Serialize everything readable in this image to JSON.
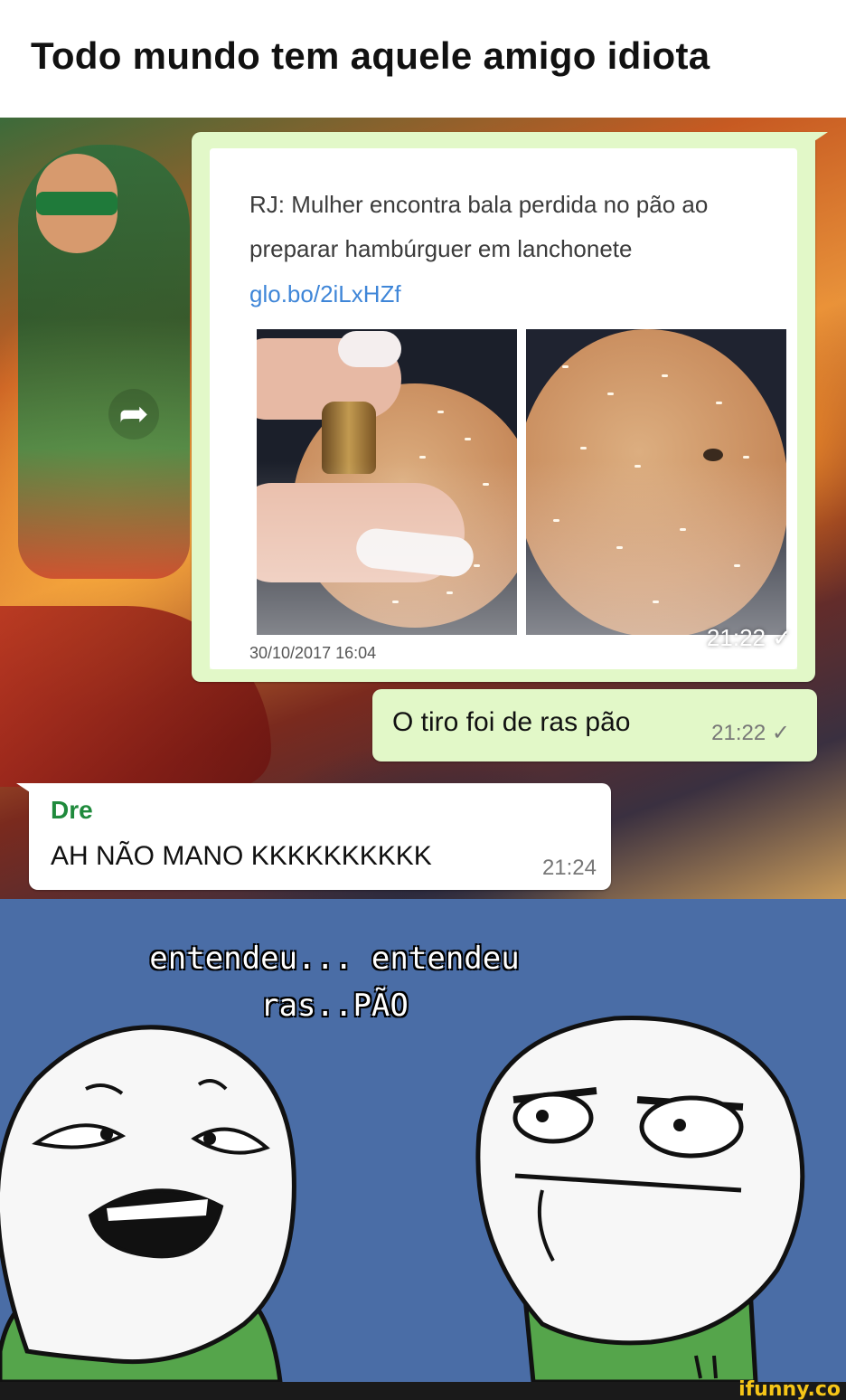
{
  "title": "Todo mundo tem aquele amigo idiota",
  "chat": {
    "forwarded": {
      "headline": "RJ: Mulher encontra bala perdida no pão ao preparar hambúrguer em lanchonete",
      "link": "glo.bo/2iLxHZf",
      "date": "30/10/2017 16:04",
      "time": "21:22 ✓"
    },
    "reply_out": {
      "text": "O tiro foi de ras pão",
      "time": "21:22 ✓"
    },
    "reply_in": {
      "sender": "Dre",
      "text": "AH NÃO MANO KKKKKKKKKK",
      "time": "21:24"
    }
  },
  "comic": {
    "caption_line1": "entendeu... entendeu",
    "caption_line2": "ras..PÃO"
  },
  "watermark": "ifunny.co",
  "icons": {
    "forward": "forward-arrow-icon",
    "check": "single-check-icon"
  },
  "colors": {
    "outgoing_bubble": "#e2f8c8",
    "incoming_bubble": "#ffffff",
    "sender_name": "#1f8a3c",
    "link": "#3f86d8",
    "comic_background": "#4a6da6"
  }
}
